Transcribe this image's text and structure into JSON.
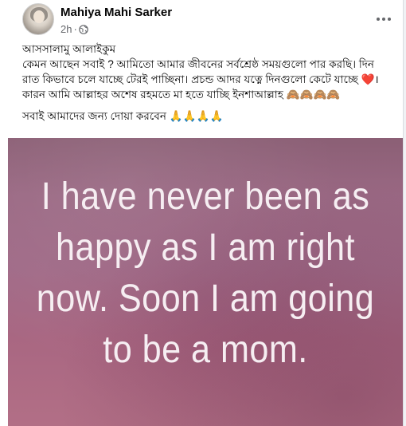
{
  "post": {
    "author_name": "Mahiya Mahi Sarker",
    "time": "2h",
    "separator": "·",
    "audience_icon": "globe-icon",
    "more_icon": "more-options-icon",
    "lines": [
      "আসসালামু আলাইকুম",
      "কেমন আছেন সবাই ? আমিতো আমার জীবনের সর্বশ্রেষ্ঠ সময়গুলো পার করছি। দিন",
      "রাত কিভাবে চলে যাচ্ছে টেরই পাচ্ছিনা। প্রচন্ড আদর যত্নে দিনগুলো কেটে যাচ্ছে ❤️।",
      "কারন আমি আল্লাহর অশেষ রহমতে মা হতে যাচ্ছি ইনশাআল্লাহ 🙈🙈🙈🙈"
    ],
    "closing_line": "সবাই আমাদের জন্য দোয়া করবেন 🙏🙏🙏🙏",
    "image_text_lines": [
      "I have never been as",
      "happy as I am right",
      "now. Soon I am going",
      "to be a mom."
    ]
  },
  "colors": {
    "name": "#050505",
    "meta": "#65676b",
    "image_text": "#f6eef2"
  }
}
